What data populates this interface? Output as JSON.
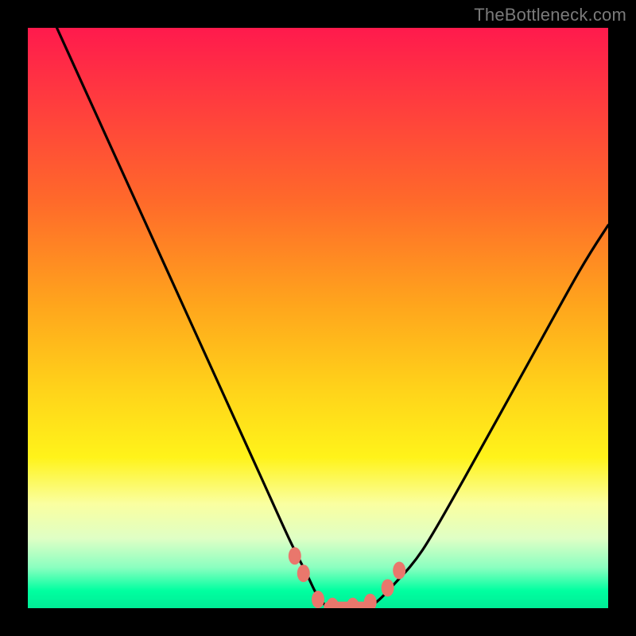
{
  "watermark": "TheBottleneck.com",
  "chart_data": {
    "type": "line",
    "title": "",
    "xlabel": "",
    "ylabel": "",
    "xlim": [
      0,
      100
    ],
    "ylim": [
      0,
      100
    ],
    "grid": false,
    "legend": false,
    "series": [
      {
        "name": "bottleneck-curve",
        "x": [
          5,
          10,
          15,
          20,
          25,
          30,
          35,
          40,
          45,
          48,
          50,
          52,
          54,
          56,
          58,
          60,
          63,
          68,
          75,
          85,
          95,
          100
        ],
        "values": [
          100,
          89,
          78,
          67,
          56,
          45,
          34,
          23,
          12,
          6,
          2,
          0,
          0,
          0,
          0,
          1,
          4,
          10,
          22,
          40,
          58,
          66
        ]
      }
    ],
    "markers": [
      {
        "x": 46.0,
        "y": 9.0
      },
      {
        "x": 47.5,
        "y": 6.0
      },
      {
        "x": 50.0,
        "y": 1.5
      },
      {
        "x": 52.5,
        "y": 0.3
      },
      {
        "x": 56.0,
        "y": 0.3
      },
      {
        "x": 59.0,
        "y": 1.0
      },
      {
        "x": 62.0,
        "y": 3.5
      },
      {
        "x": 64.0,
        "y": 6.5
      }
    ],
    "flat_segment": {
      "x_start": 51,
      "x_end": 59,
      "y": 0.3
    }
  },
  "colors": {
    "curve": "#000000",
    "markers": "#e9776c",
    "background_top": "#ff1a4d",
    "background_bottom": "#00ec96",
    "frame": "#000000"
  }
}
